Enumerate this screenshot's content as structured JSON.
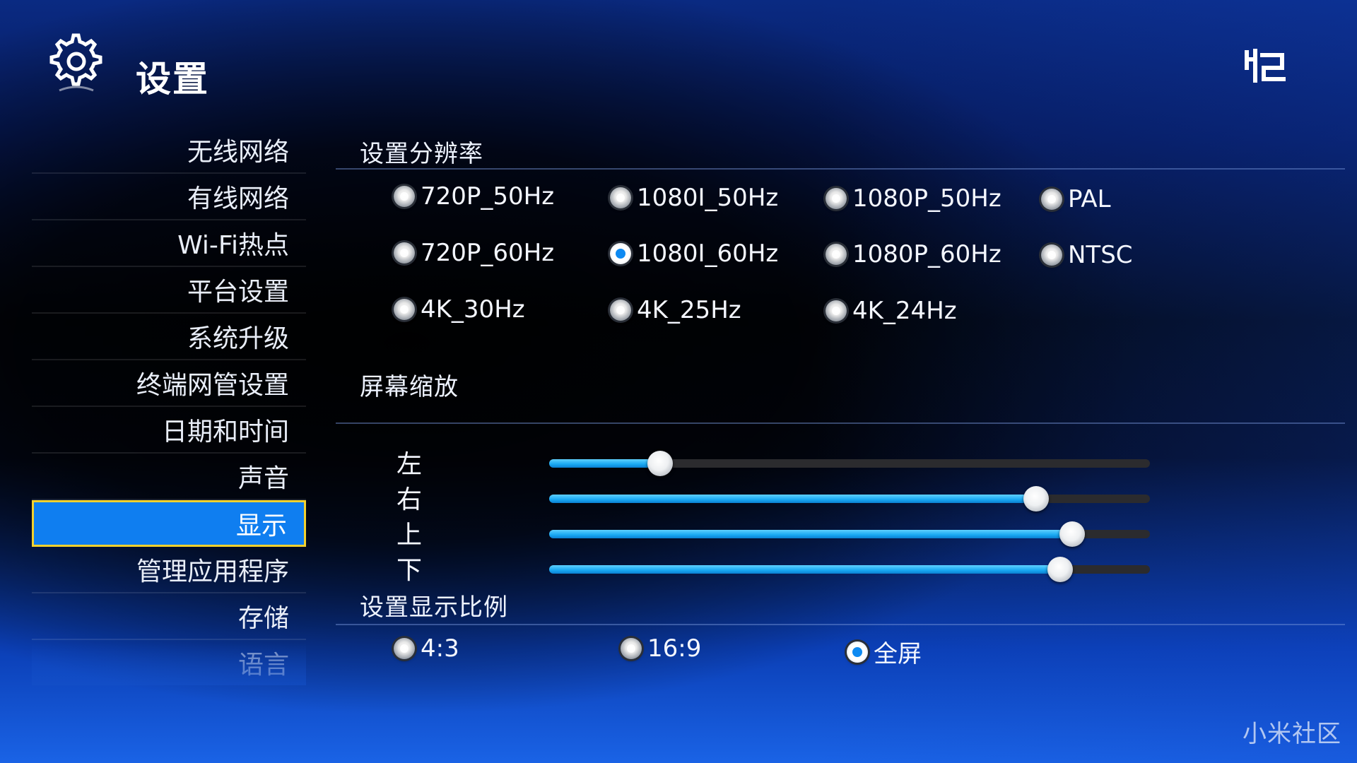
{
  "header": {
    "title": "设置"
  },
  "sidebar": {
    "items": [
      {
        "label": "无线网络"
      },
      {
        "label": "有线网络"
      },
      {
        "label": "Wi-Fi热点"
      },
      {
        "label": "平台设置"
      },
      {
        "label": "系统升级"
      },
      {
        "label": "终端网管设置"
      },
      {
        "label": "日期和时间"
      },
      {
        "label": "声音"
      },
      {
        "label": "显示",
        "active": true
      },
      {
        "label": "管理应用程序"
      },
      {
        "label": "存储"
      },
      {
        "label": "语言"
      }
    ]
  },
  "resolution": {
    "title": "设置分辨率",
    "options": [
      {
        "label": "720P_50Hz",
        "selected": false
      },
      {
        "label": "1080I_50Hz",
        "selected": false
      },
      {
        "label": "1080P_50Hz",
        "selected": false
      },
      {
        "label": "PAL",
        "selected": false
      },
      {
        "label": "720P_60Hz",
        "selected": false
      },
      {
        "label": "1080I_60Hz",
        "selected": true
      },
      {
        "label": "1080P_60Hz",
        "selected": false
      },
      {
        "label": "NTSC",
        "selected": false
      },
      {
        "label": "4K_30Hz",
        "selected": false
      },
      {
        "label": "4K_25Hz",
        "selected": false
      },
      {
        "label": "4K_24Hz",
        "selected": false
      }
    ]
  },
  "zoom": {
    "title": "屏幕缩放",
    "sliders": [
      {
        "label": "左",
        "value": 0.185
      },
      {
        "label": "右",
        "value": 0.81
      },
      {
        "label": "上",
        "value": 0.87
      },
      {
        "label": "下",
        "value": 0.85
      }
    ]
  },
  "aspect": {
    "title": "设置显示比例",
    "options": [
      {
        "label": "4:3",
        "selected": false
      },
      {
        "label": "16:9",
        "selected": false
      },
      {
        "label": "全屏",
        "selected": true
      }
    ]
  },
  "watermark": "小米社区",
  "colors": {
    "accent": "#0f7ef0",
    "focus_border": "#f2d12e",
    "slider_fill": "#18a8f2"
  }
}
